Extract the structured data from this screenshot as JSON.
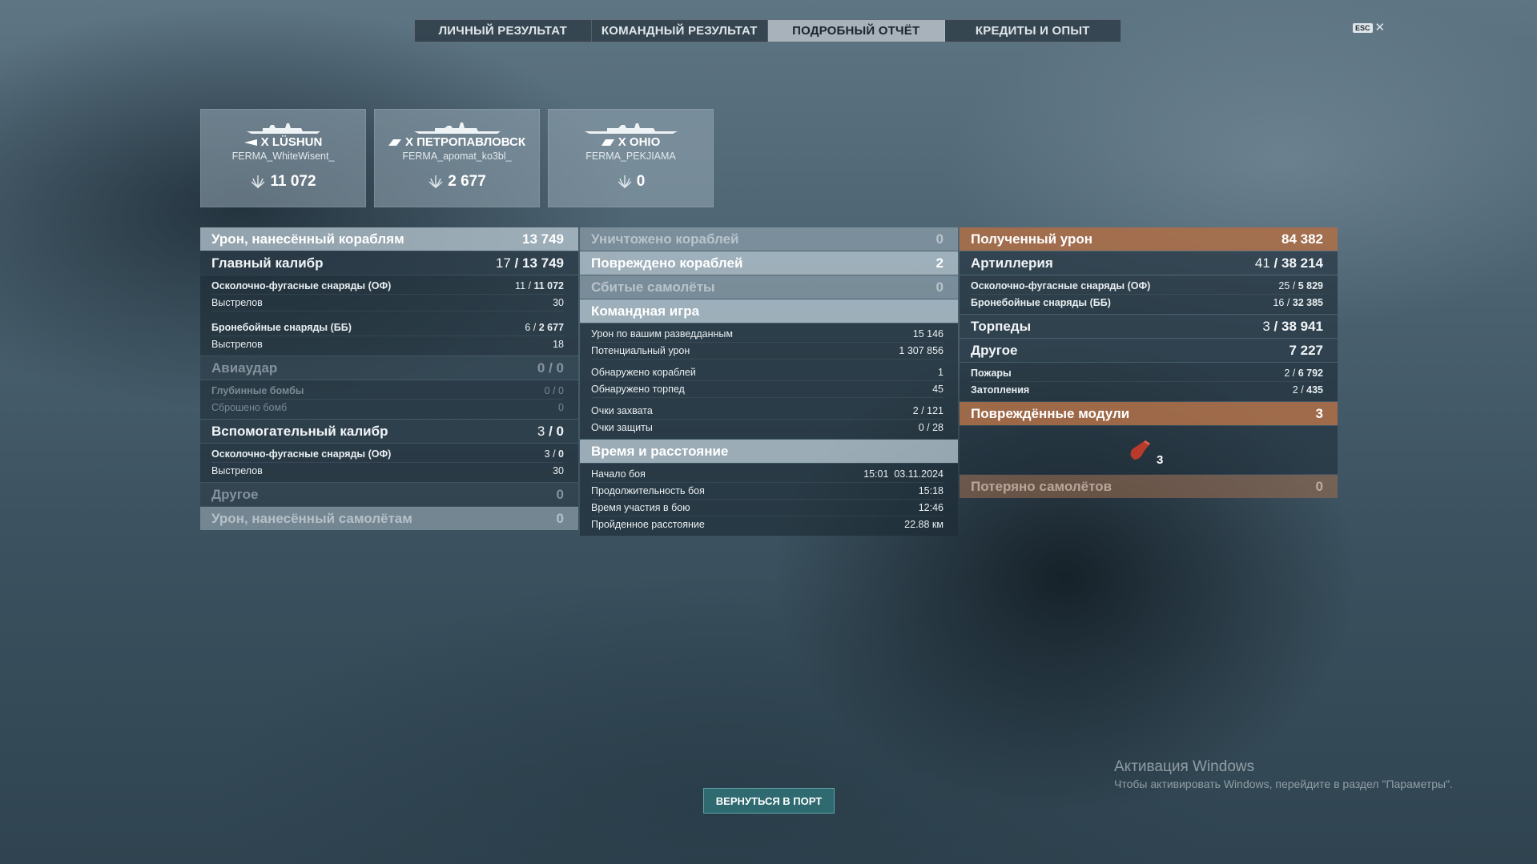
{
  "tabs": [
    {
      "label": "ЛИЧНЫЙ РЕЗУЛЬТАТ"
    },
    {
      "label": "КОМАНДНЫЙ РЕЗУЛЬТАТ"
    },
    {
      "label": "ПОДРОБНЫЙ ОТЧЁТ"
    },
    {
      "label": "КРЕДИТЫ И ОПЫТ"
    }
  ],
  "esc": {
    "key": "ESC",
    "close": "✕"
  },
  "ships": [
    {
      "name": "X LÜSHUN",
      "player": "FERMA_WhiteWisent_",
      "score": "11 072"
    },
    {
      "name": "X ПЕТРОПАВЛОВСК",
      "player": "FERMA_apomat_ko3bl_",
      "score": "2 677"
    },
    {
      "name": "X OHIO",
      "player": "FERMA_PEKJIAMA",
      "score": "0"
    }
  ],
  "damage": {
    "title": "Урон, нанесённый кораблям",
    "total": "13 749",
    "main_caliber": {
      "label": "Главный калибр",
      "hits": "17",
      "value": "13 749"
    },
    "he": {
      "label": "Осколочно-фугасные снаряды (ОФ)",
      "hits": "11",
      "value": "11 072",
      "shots_label": "Выстрелов",
      "shots": "30"
    },
    "ap": {
      "label": "Бронебойные снаряды (ББ)",
      "hits": "6",
      "value": "2 677",
      "shots_label": "Выстрелов",
      "shots": "18"
    },
    "air": {
      "label": "Авиаудар",
      "value": "0 / 0",
      "depth_label": "Глубинные бомбы",
      "depth": "0 / 0",
      "bombs_label": "Сброшено бомб",
      "bombs": "0"
    },
    "secondary": {
      "label": "Вспомогательный калибр",
      "hits": "3",
      "value": "0",
      "he_label": "Осколочно-фугасные снаряды (ОФ)",
      "he_hits": "3",
      "he_value": "0",
      "shots_label": "Выстрелов",
      "shots": "30"
    },
    "other": {
      "label": "Другое",
      "value": "0"
    },
    "planes": {
      "label": "Урон, нанесённый самолётам",
      "value": "0"
    }
  },
  "team": {
    "destroyed": {
      "label": "Уничтожено кораблей",
      "value": "0"
    },
    "damaged": {
      "label": "Повреждено кораблей",
      "value": "2"
    },
    "planes": {
      "label": "Сбитые самолёты",
      "value": "0"
    },
    "teamplay": {
      "label": "Командная игра"
    },
    "spotting_damage": {
      "label": "Урон по вашим разведданным",
      "value": "15 146"
    },
    "potential": {
      "label": "Потенциальный урон",
      "value": "1 307 856"
    },
    "ships_spotted": {
      "label": "Обнаружено кораблей",
      "value": "1"
    },
    "torps_spotted": {
      "label": "Обнаружено торпед",
      "value": "45"
    },
    "capture": {
      "label": "Очки захвата",
      "a": "2",
      "b": "121"
    },
    "defense": {
      "label": "Очки защиты",
      "a": "0",
      "b": "28"
    },
    "time_title": "Время и расстояние",
    "start": {
      "label": "Начало боя",
      "value": "15:01  03.11.2024"
    },
    "duration": {
      "label": "Продолжительность боя",
      "value": "15:18"
    },
    "participation": {
      "label": "Время участия в бою",
      "value": "12:46"
    },
    "distance": {
      "label": "Пройденное расстояние",
      "value": "22.88 км"
    }
  },
  "received": {
    "title": "Полученный урон",
    "total": "84 382",
    "artillery": {
      "label": "Артиллерия",
      "hits": "41",
      "value": "38 214"
    },
    "he": {
      "label": "Осколочно-фугасные снаряды (ОФ)",
      "hits": "25",
      "value": "5 829"
    },
    "ap": {
      "label": "Бронебойные снаряды (ББ)",
      "hits": "16",
      "value": "32 385"
    },
    "torpedoes": {
      "label": "Торпеды",
      "hits": "3",
      "value": "38 941"
    },
    "other": {
      "label": "Другое",
      "value": "7 227"
    },
    "fires": {
      "label": "Пожары",
      "hits": "2",
      "value": "6 792"
    },
    "floods": {
      "label": "Затопления",
      "hits": "2",
      "value": "435"
    },
    "modules": {
      "label": "Повреждённые модули",
      "value": "3",
      "icon_count": "3"
    },
    "lost_planes": {
      "label": "Потеряно самолётов",
      "value": "0"
    }
  },
  "back_button": "ВЕРНУТЬСЯ В ПОРТ",
  "watermark": {
    "line1": "Активация Windows",
    "line2": "Чтобы активировать Windows, перейдите в раздел \"Параметры\"."
  },
  "colors": {
    "accent": "#2e6a70",
    "received": "#af6e46"
  }
}
